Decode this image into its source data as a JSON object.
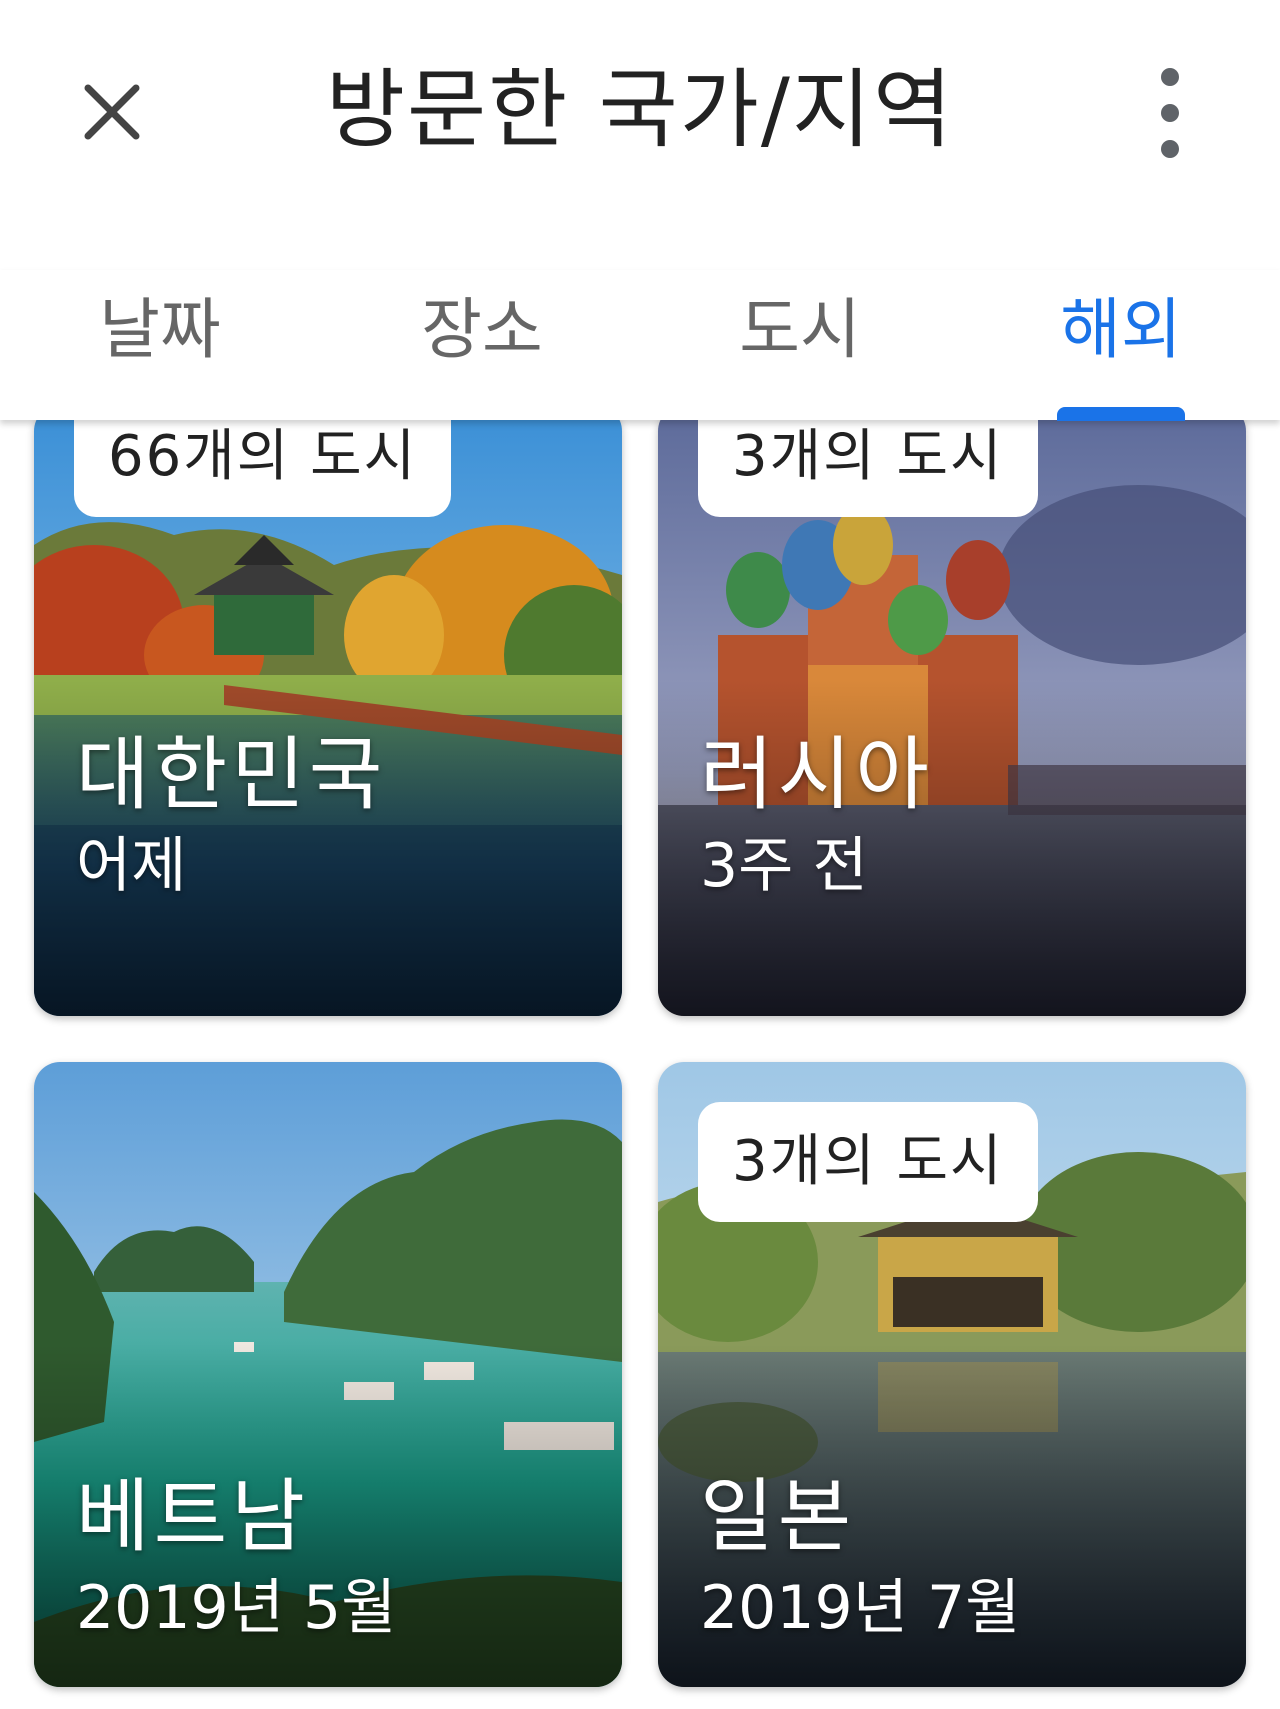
{
  "header": {
    "title": "방문한 국가/지역",
    "close_icon": "close-icon",
    "more_icon": "more-vert-icon"
  },
  "tabs": [
    {
      "label": "날짜",
      "active": false
    },
    {
      "label": "장소",
      "active": false
    },
    {
      "label": "도시",
      "active": false
    },
    {
      "label": "해외",
      "active": true
    }
  ],
  "colors": {
    "accent": "#1a73e8",
    "tab_inactive": "#666666",
    "title": "#222222"
  },
  "cards": [
    {
      "badge": "66개의 도시",
      "country": "대한민국",
      "when": "어제"
    },
    {
      "badge": "3개의 도시",
      "country": "러시아",
      "when": "3주 전"
    },
    {
      "badge": "",
      "country": "베트남",
      "when": "2019년 5월"
    },
    {
      "badge": "3개의 도시",
      "country": "일본",
      "when": "2019년 7월"
    }
  ]
}
